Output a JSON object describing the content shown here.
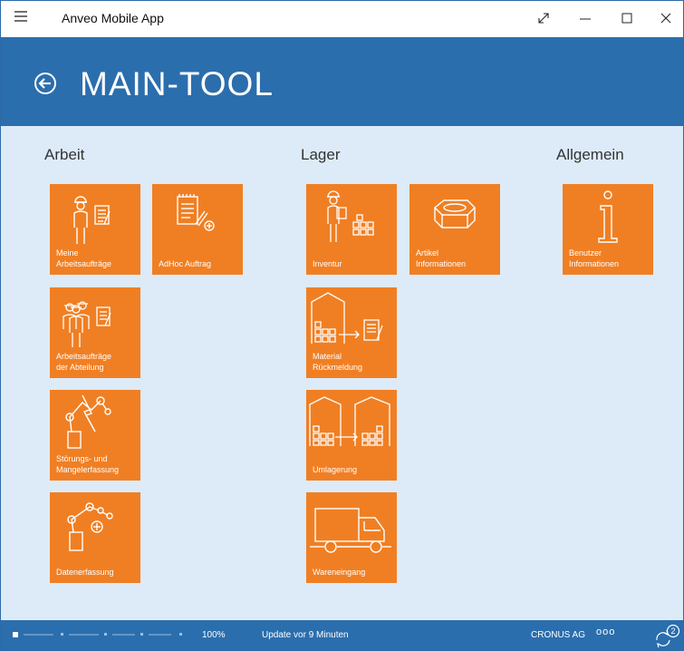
{
  "app": {
    "title": "Anveo Mobile App"
  },
  "header": {
    "title": "MAIN-TOOL"
  },
  "groups": {
    "arbeit": {
      "title": "Arbeit"
    },
    "lager": {
      "title": "Lager"
    },
    "allgemein": {
      "title": "Allgemein"
    }
  },
  "tiles": {
    "meine": {
      "label": "Meine\nArbeitsaufträge",
      "icon": "worker-document-icon"
    },
    "adhoc": {
      "label": "AdHoc Auftrag",
      "icon": "notepad-add-icon"
    },
    "abteilung": {
      "label": "Arbeitsaufträge\nder Abteilung",
      "icon": "team-document-icon"
    },
    "stoerungen": {
      "label": "Störungs- und\nMangelerfassung",
      "icon": "robot-arm-fault-icon"
    },
    "daten": {
      "label": "Datenerfassung",
      "icon": "robot-arm-add-icon"
    },
    "inventur": {
      "label": "Inventur",
      "icon": "inventory-worker-icon"
    },
    "artikel": {
      "label": "Artikel\nInformationen",
      "icon": "item-box-icon"
    },
    "material": {
      "label": "Material\nRückmeldung",
      "icon": "warehouse-document-icon"
    },
    "umlagerung": {
      "label": "Umlagerung",
      "icon": "warehouse-transfer-icon"
    },
    "wareneingang": {
      "label": "Wareneingang",
      "icon": "truck-icon"
    },
    "benutzer": {
      "label": "Benutzer\nInformationen",
      "icon": "info-icon"
    }
  },
  "status": {
    "zoom": "100%",
    "update": "Update vor 9 Minuten",
    "company": "CRONUS AG",
    "more": "ooo",
    "sync_count": "2"
  },
  "colors": {
    "header": "#2b6ead",
    "background": "#ddebf9",
    "tile": "#f07f23"
  }
}
